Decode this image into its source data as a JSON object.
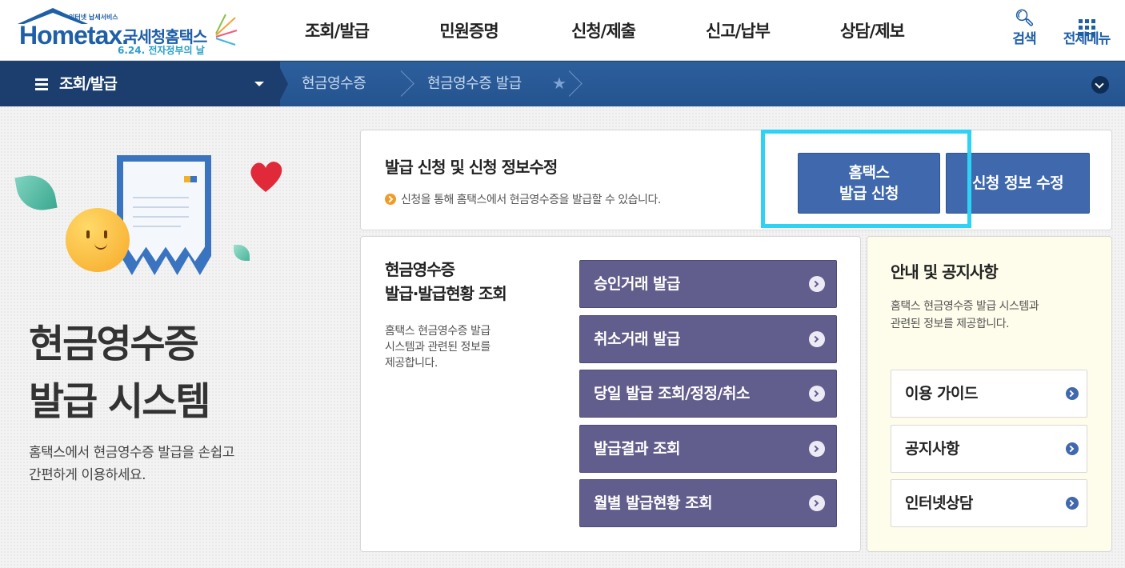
{
  "header": {
    "logo": {
      "small_text": "인터넷 납세서비스",
      "brand": "Hometax.",
      "name_kr": "국세청홈택스",
      "event": "6.24. 전자정부의 날"
    },
    "nav": [
      "조회/발급",
      "민원증명",
      "신청/제출",
      "신고/납부",
      "상담/제보"
    ],
    "search_label": "검색",
    "all_menu_label": "전체메뉴"
  },
  "location": {
    "menu": "조회/발급",
    "crumbs": [
      "현금영수증",
      "현금영수증 발급"
    ]
  },
  "hero": {
    "title_line1": "현금영수증",
    "title_line2": "발급 시스템",
    "desc_line1": "홈택스에서 현금영수증 발급을 손쉽고",
    "desc_line2": "간편하게 이용하세요."
  },
  "apply_panel": {
    "title": "발급 신청 및 신청 정보수정",
    "note": "신청을 통해 홈택스에서 현금영수증을 발급할 수 있습니다.",
    "apply_btn_line1": "홈택스",
    "apply_btn_line2": "발급 신청",
    "modify_btn": "신청 정보 수정"
  },
  "issue_panel": {
    "title_line1": "현금영수증",
    "title_line2": "발급·발급현황 조회",
    "desc_line1": "홈택스 현금영수증 발급",
    "desc_line2": "시스템과 관련된 정보를",
    "desc_line3": "제공합니다.",
    "buttons": [
      "승인거래 발급",
      "취소거래 발급",
      "당일 발급 조회/정정/취소",
      "발급결과 조회",
      "월별 발급현황 조회"
    ]
  },
  "info_panel": {
    "title": "안내 및 공지사항",
    "desc_line1": "홈택스 현금영수증 발급 시스템과",
    "desc_line2": "관련된 정보를 제공합니다.",
    "buttons": [
      "이용 가이드",
      "공지사항",
      "인터넷상담"
    ]
  },
  "colors": {
    "primary_blue": "#3f68ad",
    "purple_button": "#615d8c",
    "highlight": "#2ed2f5",
    "notice_bg": "#fefcea"
  }
}
